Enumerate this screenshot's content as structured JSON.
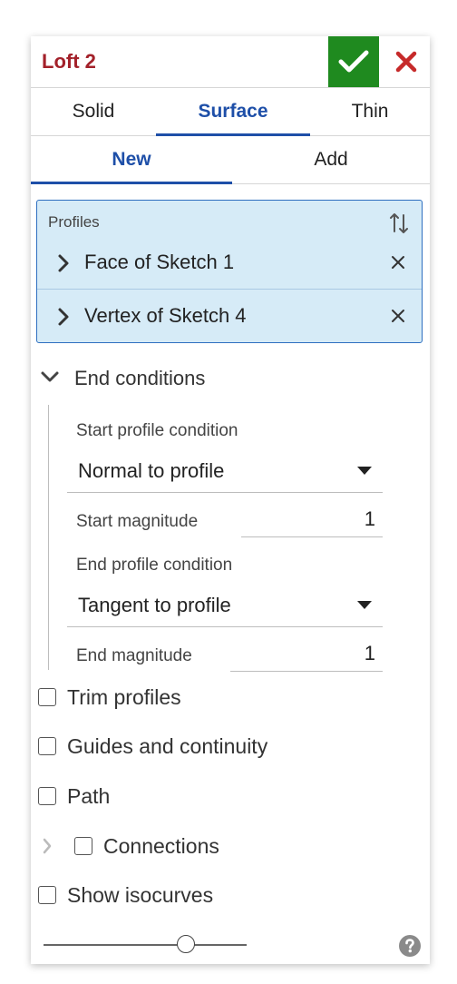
{
  "dialog": {
    "title": "Loft 2",
    "accent_color": "#1e4fa8",
    "title_color": "#a3212a",
    "confirm_color": "#1f8a1f"
  },
  "body_tabs": [
    {
      "label": "Solid",
      "active": false
    },
    {
      "label": "Surface",
      "active": true
    },
    {
      "label": "Thin",
      "active": false
    }
  ],
  "op_tabs": [
    {
      "label": "New",
      "active": true
    },
    {
      "label": "Add",
      "active": false
    }
  ],
  "profiles": {
    "label": "Profiles",
    "items": [
      {
        "label": "Face of Sketch 1"
      },
      {
        "label": "Vertex of Sketch 4"
      }
    ]
  },
  "end_conditions": {
    "label": "End conditions",
    "expanded": true,
    "start_condition_label": "Start profile condition",
    "start_condition_value": "Normal to profile",
    "start_magnitude_label": "Start magnitude",
    "start_magnitude_value": "1",
    "end_condition_label": "End profile condition",
    "end_condition_value": "Tangent to profile",
    "end_magnitude_label": "End magnitude",
    "end_magnitude_value": "1"
  },
  "options": {
    "trim_profiles": {
      "label": "Trim profiles",
      "checked": false
    },
    "guides": {
      "label": "Guides and continuity",
      "checked": false
    },
    "path": {
      "label": "Path",
      "checked": false
    },
    "connections": {
      "label": "Connections",
      "checked": false
    },
    "isocurves": {
      "label": "Show isocurves",
      "checked": false
    }
  },
  "slider": {
    "value": 0.7
  }
}
